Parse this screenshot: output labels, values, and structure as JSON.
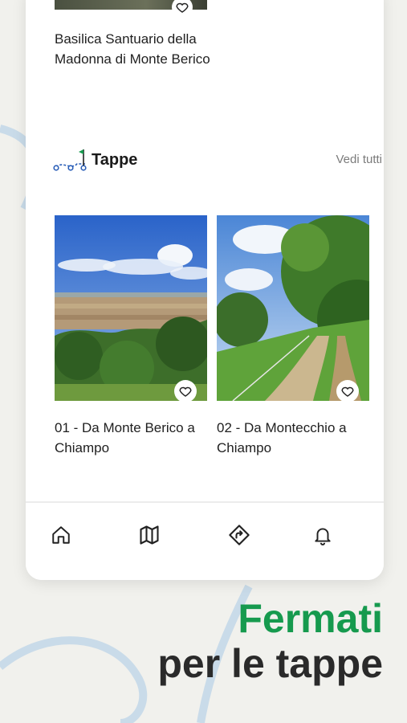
{
  "previous_item": {
    "title": "Basilica Santuario della Madonna di Monte Berico"
  },
  "section": {
    "title": "Tappe",
    "see_all": "Vedi tutti",
    "icon": "route-flag-icon"
  },
  "stages": [
    {
      "title": "01 - Da Monte Berico a Chiampo",
      "favorite_icon": "heart-outline-icon"
    },
    {
      "title": "02 - Da Montecchio a Chiampo",
      "favorite_icon": "heart-outline-icon"
    }
  ],
  "nav": [
    {
      "icon": "home-icon"
    },
    {
      "icon": "map-icon"
    },
    {
      "icon": "directions-icon"
    },
    {
      "icon": "bell-icon"
    }
  ],
  "tagline": {
    "line1": "Fermati",
    "line2": "per le tappe"
  },
  "colors": {
    "accent_green": "#169a4e",
    "background": "#f1f1ed",
    "decor_blue": "#c9dbe9"
  }
}
